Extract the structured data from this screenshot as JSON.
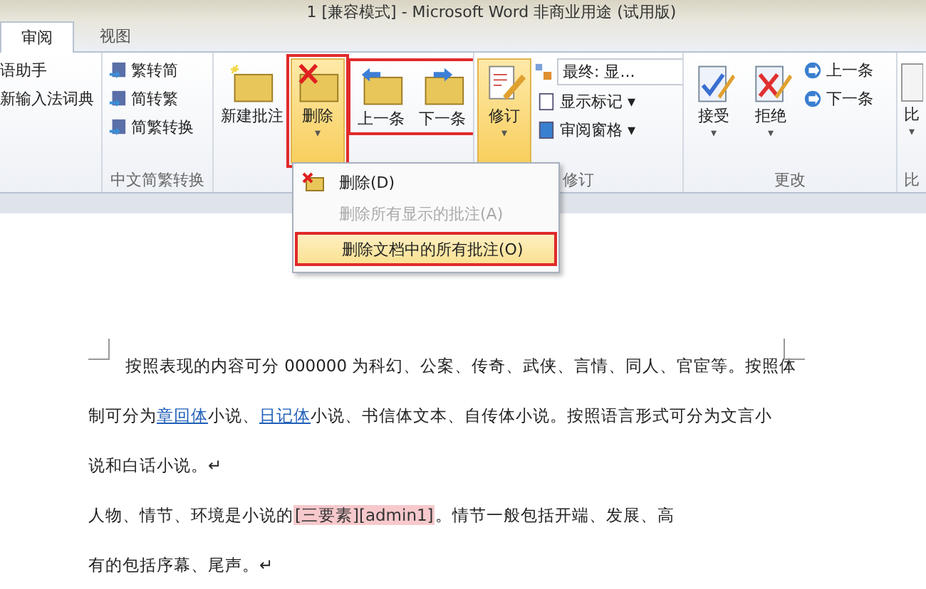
{
  "window": {
    "title": "1 [兼容模式] - Microsoft Word 非商业用途 (试用版)"
  },
  "tabs": [
    {
      "label": "审阅",
      "selected": true
    },
    {
      "label": "视图",
      "selected": false
    }
  ],
  "ribbon": {
    "groups": [
      {
        "kind": "list",
        "items": [
          {
            "label": "语助手"
          },
          {
            "label": "新输入法词典"
          }
        ]
      },
      {
        "kind": "list",
        "label": "中文简繁转换",
        "items": [
          {
            "label": "繁转简"
          },
          {
            "label": "简转繁"
          },
          {
            "label": "简繁转换"
          }
        ]
      },
      {
        "kind": "comments",
        "buttons": [
          {
            "label": "新建批注",
            "pressed": false,
            "marked": false
          },
          {
            "label": "删除",
            "pressed": true,
            "marked": true,
            "caret": "▾"
          }
        ],
        "nav": {
          "marked": true,
          "buttons": [
            {
              "label": "上一条"
            },
            {
              "label": "下一条"
            }
          ]
        }
      },
      {
        "kind": "track",
        "label": "修订",
        "button": {
          "label": "修订",
          "pressed": true,
          "caret": "▾"
        },
        "dropdown": "最终: 显...",
        "items": [
          {
            "label": "显示标记",
            "caret": "▾"
          },
          {
            "label": "审阅窗格",
            "caret": "▾"
          }
        ]
      },
      {
        "kind": "changes",
        "label": "更改",
        "buttons": [
          {
            "label": "接受",
            "caret": "▾"
          },
          {
            "label": "拒绝",
            "caret": "▾"
          }
        ],
        "items": [
          {
            "label": "上一条"
          },
          {
            "label": "下一条"
          }
        ]
      },
      {
        "kind": "partial",
        "label": "比",
        "button": {
          "label": "比",
          "caret": "▾"
        }
      }
    ]
  },
  "menu": {
    "items": [
      {
        "label": "删除(D)",
        "disabled": false,
        "selected": false
      },
      {
        "label": "删除所有显示的批注(A)",
        "disabled": true,
        "selected": false
      },
      {
        "label": "删除文档中的所有批注(O)",
        "disabled": false,
        "selected": true
      }
    ]
  },
  "document": {
    "lines": [
      {
        "indent": true,
        "segments": [
          {
            "kind": "text",
            "text": "按照表现的内容可分 000000 为科幻、公案、传奇、武侠、言情、同人、官宦等。按照体"
          }
        ]
      },
      {
        "indent": false,
        "segments": [
          {
            "kind": "text",
            "text": "制可分为"
          },
          {
            "kind": "link",
            "text": "章回体"
          },
          {
            "kind": "text",
            "text": "小说、"
          },
          {
            "kind": "link",
            "text": "日记体"
          },
          {
            "kind": "text",
            "text": "小说、书信体文本、自传体小说。按照语言形式可分为文言小"
          }
        ]
      },
      {
        "indent": false,
        "segments": [
          {
            "kind": "text",
            "text": "说和白话小说。↵"
          }
        ]
      },
      {
        "indent": false,
        "segments": [
          {
            "kind": "text",
            "text": "人物、情节、环境是小说的"
          },
          {
            "kind": "comment",
            "text": "[三要素]",
            "author": "[admin1]"
          },
          {
            "kind": "text",
            "text": "。情节一般包括开端、发展、高"
          }
        ]
      },
      {
        "indent": false,
        "segments": [
          {
            "kind": "text",
            "text": "有的包括序幕、尾声。↵"
          }
        ]
      }
    ]
  }
}
